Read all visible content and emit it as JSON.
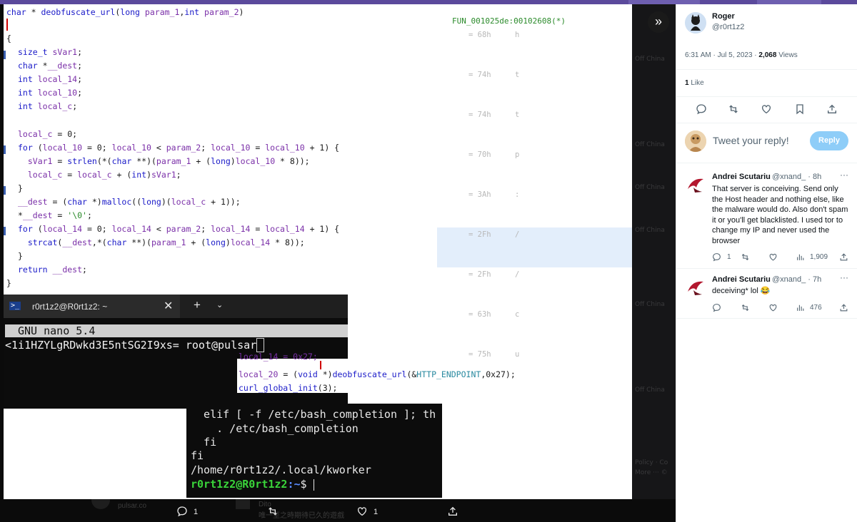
{
  "code": {
    "signature": "char * deobfuscate_url(long param_1,int param_2)",
    "open_brace": "{",
    "close_brace": "}",
    "decl1": "size_t sVar1;",
    "decl2": "char *__dest;",
    "decl3": "int local_14;",
    "decl4": "int local_10;",
    "decl5": "int local_c;",
    "l1": "local_c = 0;",
    "l2": "for (local_10 = 0; local_10 < param_2; local_10 = local_10 + 1) {",
    "l3": "  sVar1 = strlen(*(char **)(param_1 + (long)local_10 * 8));",
    "l4": "  local_c = local_c + (int)sVar1;",
    "l5": "}",
    "l6": "__dest = (char *)malloc((long)(local_c + 1));",
    "l7": "*__dest = '\\0';",
    "l8": "for (local_14 = 0; local_14 < param_2; local_14 = local_14 + 1) {",
    "l9": "  strcat(__dest,*(char **)(param_1 + (long)local_14 * 8));",
    "l10": "}",
    "l11": "return __dest;"
  },
  "listing": {
    "fun_label": "FUN_001025de:00102608(*)",
    "rows": [
      {
        "hex": "= 68h",
        "ch": "h"
      },
      {
        "hex": "= 74h",
        "ch": "t"
      },
      {
        "hex": "= 74h",
        "ch": "t"
      },
      {
        "hex": "= 70h",
        "ch": "p"
      },
      {
        "hex": "= 3Ah",
        "ch": ":"
      },
      {
        "hex": "= 2Fh",
        "ch": "/"
      },
      {
        "hex": "= 2Fh",
        "ch": "/"
      },
      {
        "hex": "= 63h",
        "ch": "c"
      },
      {
        "hex": "= 75h",
        "ch": "u"
      }
    ]
  },
  "terminal": {
    "tab_title": "r0rt1z2@R0rt1z2: ~",
    "tab_icon": ">_",
    "close_glyph": "✕",
    "plus_glyph": "+",
    "dropdown_glyph": "⌄",
    "nano_title": "GNU nano 5.4",
    "nano_line": "<1i1HZYLgRDwkd3E5ntSG2I9xs= root@pulsar"
  },
  "snippet": {
    "line0": "local_14 = 0x27;",
    "line1": "local_20 = (void *)deobfuscate_url(&HTTP_ENDPOINT,0x27);",
    "line2": "curl_global_init(3);"
  },
  "terminal2": {
    "line1": "  elif [ -f /etc/bash_completion ]; th",
    "line2": "    . /etc/bash_completion",
    "line3": "  fi",
    "line4": "fi",
    "line5": "/home/r0rt1z2/.local/kworker",
    "prompt_user": "r0rt1z2@R0rt1z2",
    "prompt_path": ":~",
    "prompt_sym": "$ "
  },
  "bottom": {
    "reply_count": "1",
    "like_count": "1",
    "ghost_name": "Dito",
    "ghost_text": "唯一至之時期待已久的遊戲"
  },
  "tweet": {
    "author_name": "Roger",
    "author_handle": "@r0rt1z2",
    "time": "6:31 AM · Jul 5, 2023 · ",
    "views_count": "2,068",
    "views_label": " Views",
    "likes_count": "1",
    "likes_label": " Like",
    "reply_prompt": "Tweet your reply!",
    "reply_button": "Reply"
  },
  "replies": [
    {
      "name": "Andrei Scutariu",
      "handle": "@xnand_ · 8h",
      "text": "That server is conceiving. Send only the Host header and nothing else, like the malware would do. Also don't spam it or you'll get blacklisted. I used tor to change my IP and never used the browser",
      "reply_count": "1",
      "views": "1,909"
    },
    {
      "name": "Andrei Scutariu",
      "handle": "@xnand_ · 7h",
      "text": "deceiving* lol 😂",
      "reply_count": "",
      "views": "476"
    }
  ],
  "colors": {
    "accent": "#1d9bf0",
    "reply_button": "#8ecdf8",
    "keyword": "#1a1ac8",
    "variable": "#7a2fa8",
    "prompt_green": "#3ad43a"
  }
}
